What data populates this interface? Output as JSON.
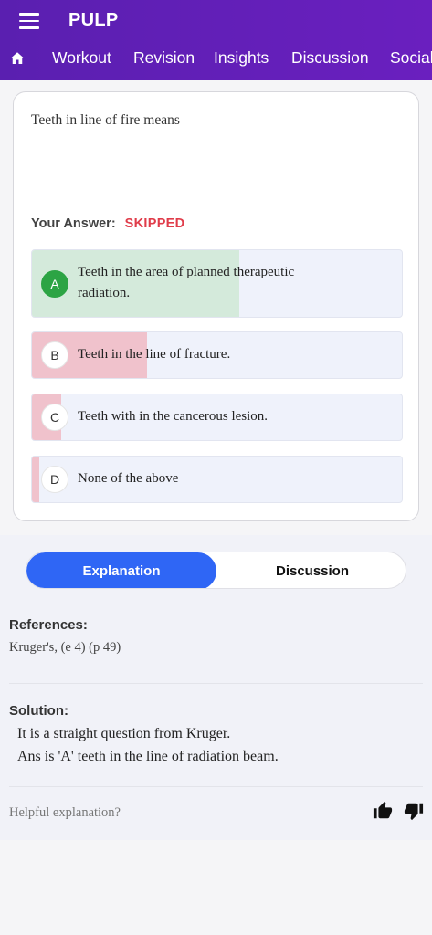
{
  "app": {
    "title": "PULP"
  },
  "icons": {
    "menu": "hamburger-menu-icon",
    "home": "home-icon",
    "like": "thumbs-up-icon",
    "dislike": "thumbs-down-icon"
  },
  "nav": {
    "items": [
      "Workout",
      "Revision",
      "Insights",
      "Discussion",
      "Social"
    ]
  },
  "question": {
    "text": "Teeth in line of fire means",
    "answer_label": "Your Answer:",
    "answer_value": "SKIPPED"
  },
  "options": [
    {
      "letter": "A",
      "text": "Teeth in the area of planned therapeutic radiation.",
      "correct": true,
      "share": 0.56
    },
    {
      "letter": "B",
      "text": "Teeth in the line of fracture.",
      "correct": false,
      "share": 0.31
    },
    {
      "letter": "C",
      "text": "Teeth with in the cancerous lesion.",
      "correct": false,
      "share": 0.08
    },
    {
      "letter": "D",
      "text": "None of the above",
      "correct": false,
      "share": 0.02
    }
  ],
  "colors": {
    "header": "#5a1fb0",
    "correct_fill": "#d4eadb",
    "correct_badge": "#2ca444",
    "wrong_fill": "#f0c2cc",
    "skipped": "#e03c4a",
    "tab_active": "#2f66f5"
  },
  "tabs": {
    "explanation": "Explanation",
    "discussion": "Discussion"
  },
  "explanation": {
    "references_title": "References:",
    "references": "Kruger's, (e 4) (p 49)",
    "solution_title": "Solution:",
    "solution_lines": [
      "It is a straight question from Kruger.",
      "Ans is 'A' teeth in the line of radiation beam."
    ],
    "helpful_prompt": "Helpful explanation?"
  }
}
